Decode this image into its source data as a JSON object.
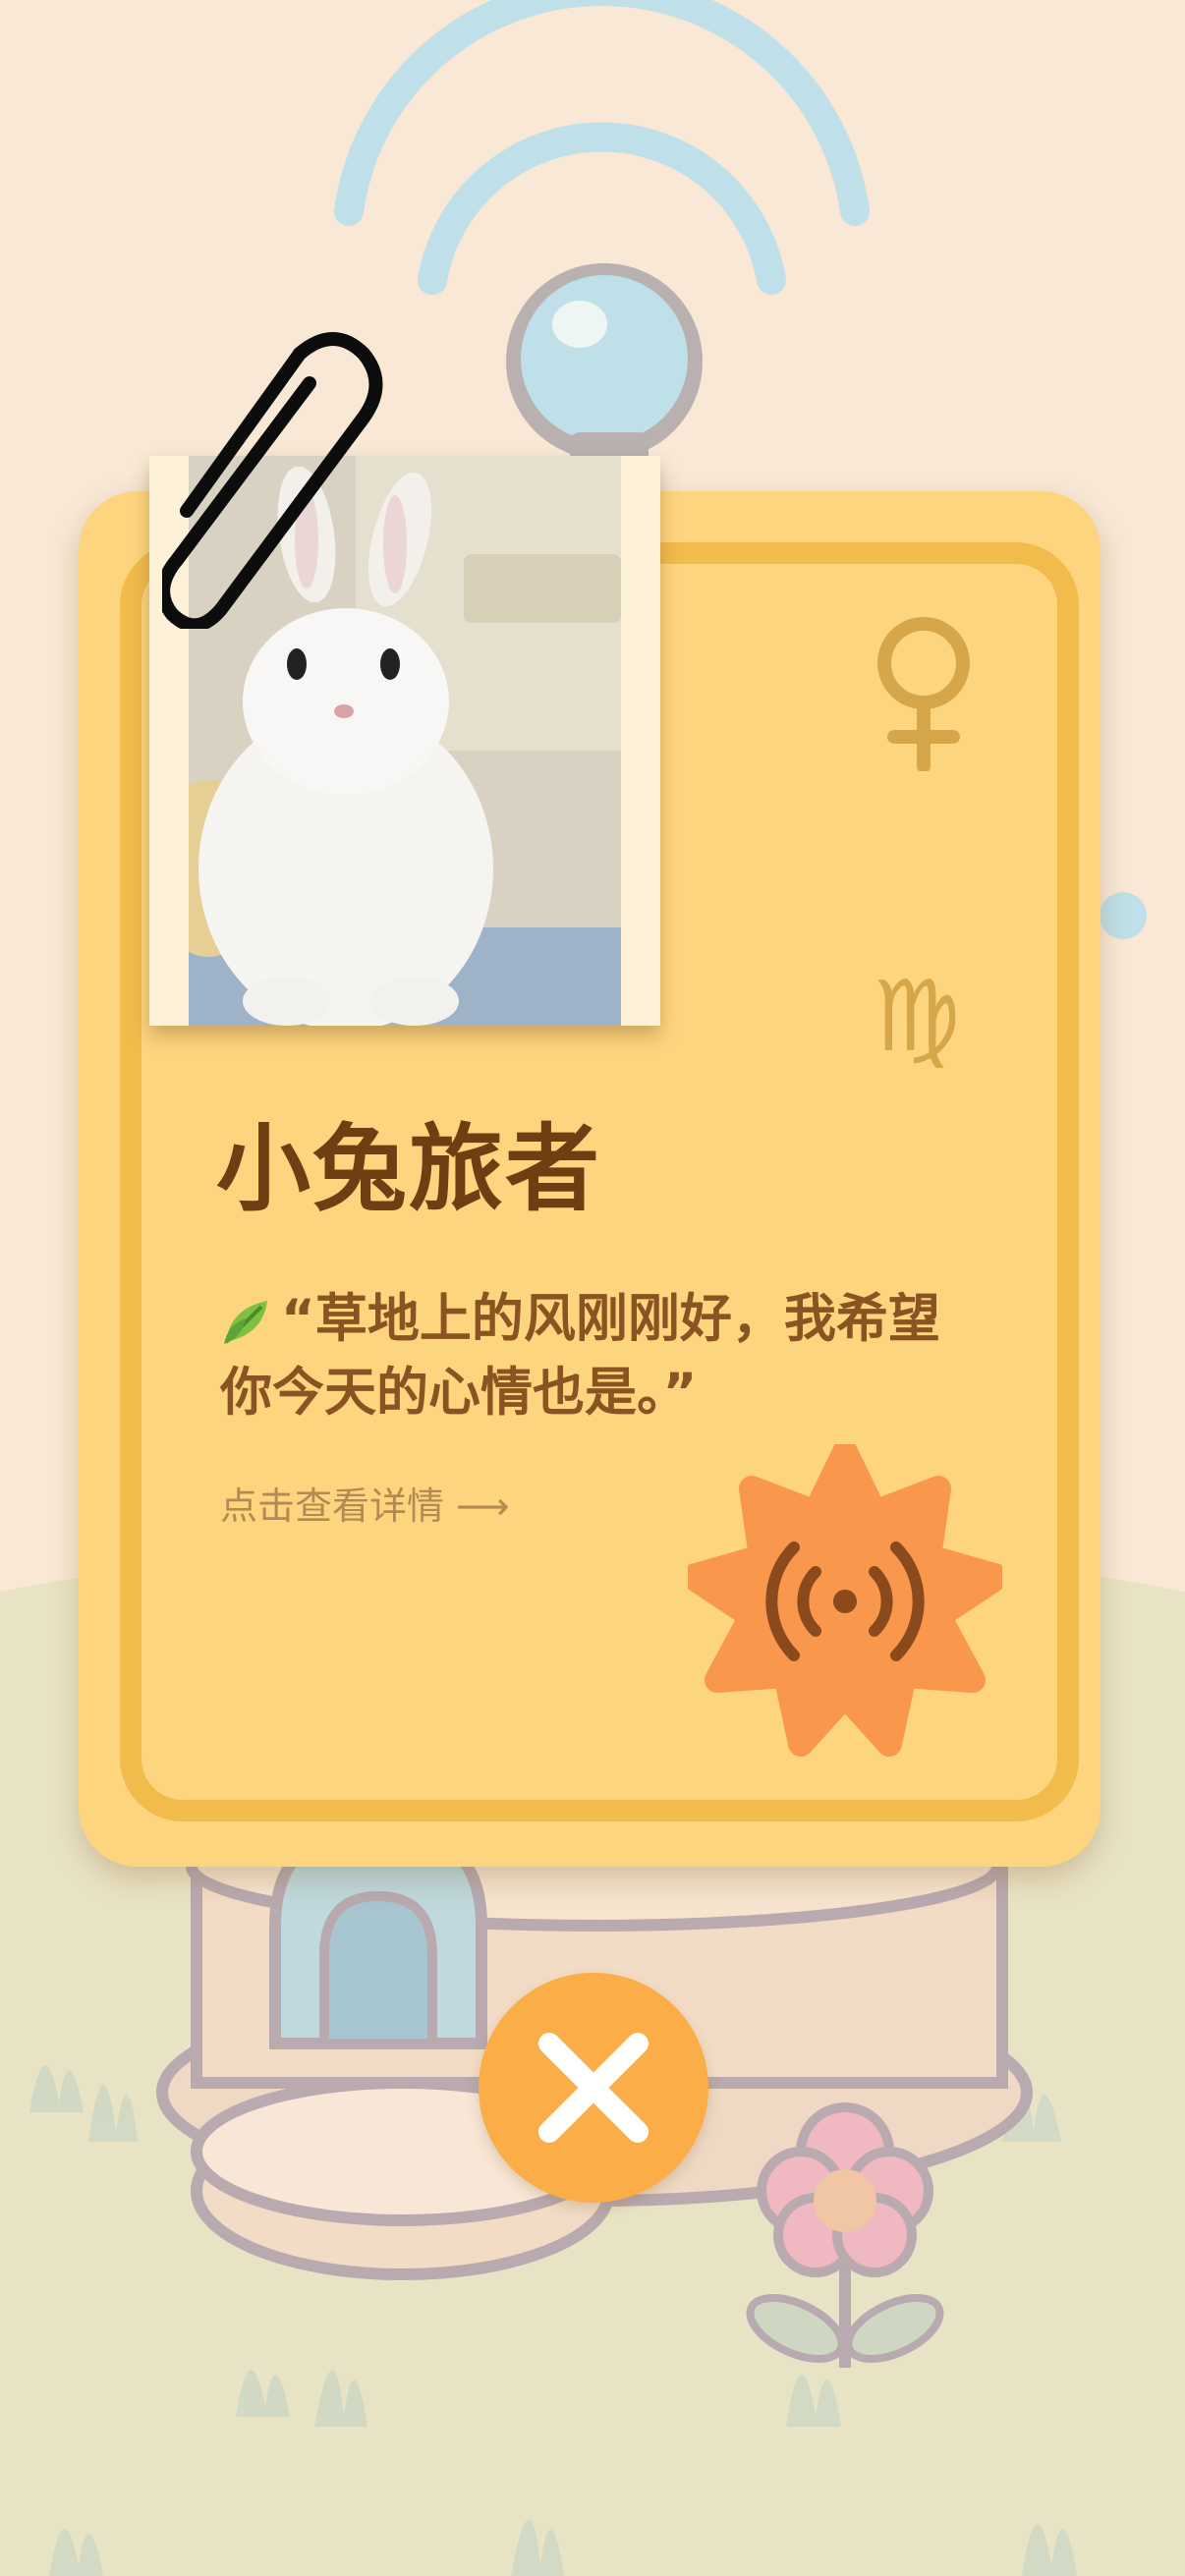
{
  "card": {
    "title": "小兔旅者",
    "quote": "“草地上的风刚刚好，我希望你今天的心情也是。”",
    "detail_link": "点击查看详情 ⟶",
    "gender_icon": "female-icon",
    "zodiac_symbol": "♍",
    "action_icon": "broadcast-icon",
    "photo_subject": "white rabbit"
  },
  "close_button": {
    "icon": "close-icon"
  },
  "colors": {
    "background": "#f8e8d5",
    "card": "#fed57f",
    "card_border": "#f2bc4d",
    "title": "#6d3f12",
    "quote": "#8a5322",
    "burst": "#f9974c",
    "close": "#fbad48"
  }
}
